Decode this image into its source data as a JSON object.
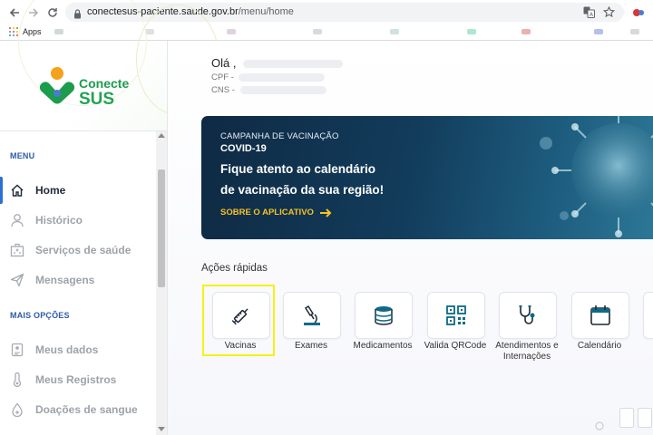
{
  "browser": {
    "url_domain": "conectesus-paciente.saude.gov.br",
    "url_path": "/menu/home",
    "bookmarks_apps_label": "Apps"
  },
  "sidebar": {
    "logo": {
      "line1": "Conecte",
      "line2": "SUS"
    },
    "menu_heading": "MENU",
    "menu_items": [
      {
        "label": "Home",
        "icon": "home-icon",
        "active": true
      },
      {
        "label": "Histórico",
        "icon": "user-icon",
        "active": false
      },
      {
        "label": "Serviços de saúde",
        "icon": "building-icon",
        "active": false
      },
      {
        "label": "Mensagens",
        "icon": "send-icon",
        "active": false
      }
    ],
    "more_heading": "MAIS OPÇÕES",
    "more_items": [
      {
        "label": "Meus dados",
        "icon": "id-card-icon"
      },
      {
        "label": "Meus Registros",
        "icon": "thermometer-icon"
      },
      {
        "label": "Doações de sangue",
        "icon": "blood-drop-icon"
      }
    ]
  },
  "main": {
    "greeting": "Olá ,",
    "cpf_label": "CPF -",
    "cns_label": "CNS -",
    "banner": {
      "kicker": "CAMPANHA DE VACINAÇÃO",
      "subject": "COVID-19",
      "headline_line1": "Fique atento ao calendário",
      "headline_line2": "de vacinação da sua região!",
      "cta": "SOBRE O APLICATIVO"
    },
    "quick_actions_title": "Ações rápidas",
    "quick_actions": [
      {
        "label": "Vacinas",
        "icon": "syringe-icon",
        "highlighted": true
      },
      {
        "label": "Exames",
        "icon": "microscope-icon"
      },
      {
        "label": "Medicamentos",
        "icon": "pill-bottle-icon"
      },
      {
        "label": "Valida QRCode",
        "icon": "qrcode-icon"
      },
      {
        "label": "Atendimentos e Internações",
        "icon": "stethoscope-icon"
      },
      {
        "label": "Calendário",
        "icon": "calendar-icon"
      }
    ]
  },
  "colors": {
    "accent_blue": "#2d6fd6",
    "brand_green": "#1c9c4d",
    "brand_orange": "#f4a11c",
    "banner_dark": "#0f2a44",
    "cta_yellow": "#f6c324",
    "highlight_yellow": "#f2f21a",
    "icon_teal": "#0d6a86"
  }
}
